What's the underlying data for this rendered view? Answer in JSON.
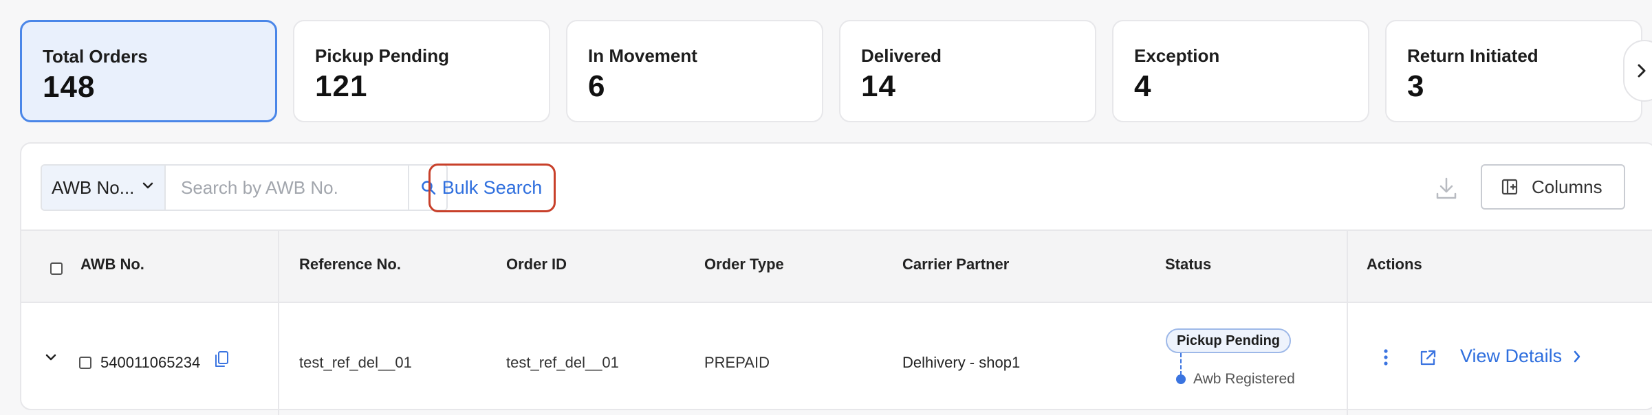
{
  "summary_cards": [
    {
      "label": "Total Orders",
      "count": "148",
      "active": true
    },
    {
      "label": "Pickup Pending",
      "count": "121"
    },
    {
      "label": "In Movement",
      "count": "6"
    },
    {
      "label": "Delivered",
      "count": "14"
    },
    {
      "label": "Exception",
      "count": "4"
    },
    {
      "label": "Return Initiated",
      "count": "3"
    }
  ],
  "toolbar": {
    "filter_selected": "AWB No...",
    "search_placeholder": "Search by AWB No.",
    "bulk_search_label": "Bulk Search",
    "columns_label": "Columns"
  },
  "table": {
    "headers": {
      "awb": "AWB No.",
      "reference": "Reference No.",
      "order_id": "Order ID",
      "order_type": "Order Type",
      "carrier": "Carrier Partner",
      "status": "Status",
      "actions": "Actions"
    },
    "rows": [
      {
        "awb": "540011065234",
        "reference": "test_ref_del__01",
        "order_id": "test_ref_del__01",
        "order_type": "PREPAID",
        "carrier": "Delhivery - shop1",
        "status": "Pickup Pending",
        "status_sub": "Awb Registered",
        "view_details": "View Details"
      }
    ]
  },
  "colors": {
    "accent": "#2f6fde",
    "active_card_bg": "#e9f0fc",
    "active_card_border": "#4a86e8",
    "highlight_border": "#c8402a"
  },
  "icons": [
    "chevron-right-icon",
    "chevron-down-icon",
    "search-icon",
    "download-icon",
    "columns-icon",
    "expand-chevron-icon",
    "copy-icon",
    "more-vertical-icon",
    "external-link-icon"
  ]
}
